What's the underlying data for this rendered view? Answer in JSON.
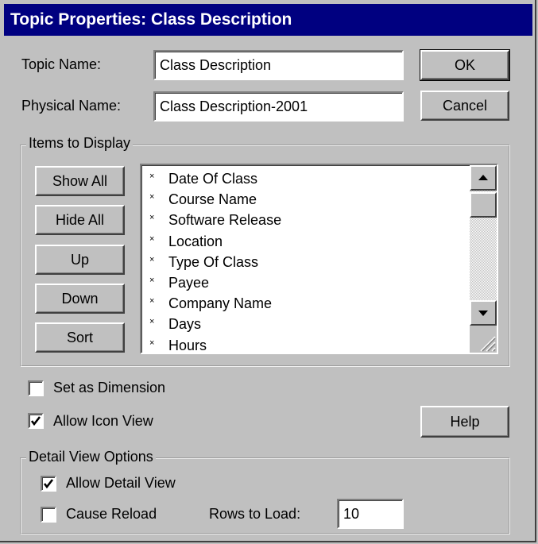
{
  "window": {
    "title": "Topic Properties: Class Description"
  },
  "form": {
    "topic_name_label": "Topic Name:",
    "topic_name_value": "Class Description",
    "physical_name_label": "Physical Name:",
    "physical_name_value": "Class Description-2001"
  },
  "buttons": {
    "ok": "OK",
    "cancel": "Cancel",
    "help": "Help"
  },
  "items_group": {
    "title": "Items to Display",
    "buttons": {
      "show_all": "Show All",
      "hide_all": "Hide All",
      "up": "Up",
      "down": "Down",
      "sort": "Sort"
    },
    "list_marker": "×",
    "items": [
      "Date Of Class",
      "Course Name",
      "Software Release",
      "Location",
      "Type Of Class",
      "Payee",
      "Company Name",
      "Days",
      "Hours"
    ]
  },
  "options": {
    "set_as_dimension": {
      "label": "Set as Dimension",
      "checked": false
    },
    "allow_icon_view": {
      "label": "Allow Icon View",
      "checked": true
    }
  },
  "detail_group": {
    "title": "Detail View Options",
    "allow_detail_view": {
      "label": "Allow Detail View",
      "checked": true
    },
    "cause_reload": {
      "label": "Cause Reload",
      "checked": false
    },
    "rows_to_load_label": "Rows to Load:",
    "rows_to_load_value": "10"
  },
  "icons": [
    "scroll-up-arrow-icon",
    "scroll-down-arrow-icon",
    "checkmark-icon",
    "resize-grip-icon"
  ]
}
